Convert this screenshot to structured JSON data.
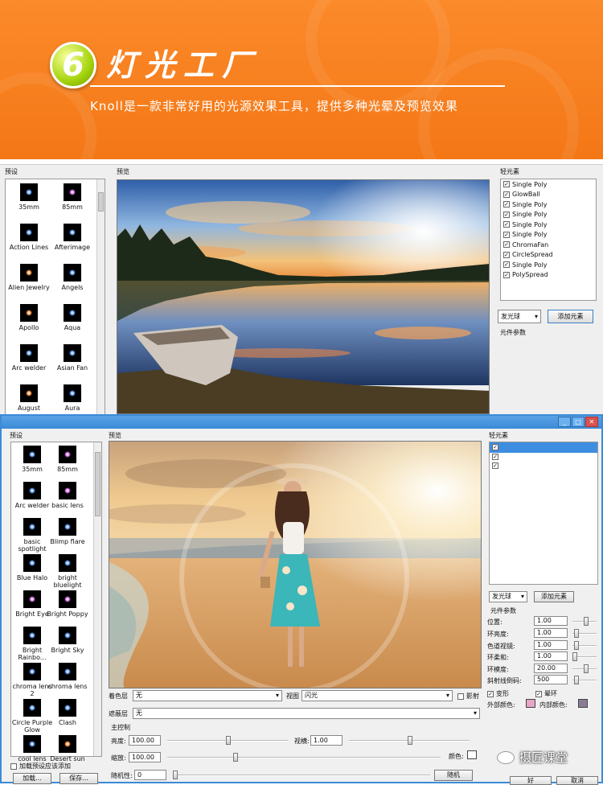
{
  "banner": {
    "number": "6",
    "title": "灯光工厂",
    "subtitle": "Knoll是一款非常好用的光源效果工具，提供多种光晕及预览效果"
  },
  "window1": {
    "presets_label": "预设",
    "preview_label": "预览",
    "elements_label": "轻元素",
    "presets": [
      "35mm",
      "85mm",
      "Action Lines",
      "Afterimage",
      "Alien Jewelry",
      "Angels",
      "Apollo",
      "Aqua",
      "Arc welder",
      "Asian Fan",
      "August",
      "Aura"
    ],
    "elements": [
      "Single Poly",
      "GlowBall",
      "Single Poly",
      "Single Poly",
      "Single Poly",
      "Single Poly",
      "ChromaFan",
      "CircleSpread",
      "Single Poly",
      "PolySpread"
    ],
    "element_select": "发光球",
    "add_button": "添加元素",
    "params_label": "元件参数"
  },
  "window2": {
    "presets_label": "预设",
    "preview_label": "预览",
    "elements_label": "轻元素",
    "presets": [
      "35mm",
      "85mm",
      "Arc welder",
      "basic lens",
      "basic spotlight",
      "Blimp flare",
      "Blue Halo",
      "bright bluelight",
      "Bright Eye",
      "Bright Poppy",
      "Bright Rainbo...",
      "Bright Sky",
      "chroma lens 2",
      "chroma lens",
      "Circle Purple Glow",
      "Clash",
      "cool lens",
      "Desert sun"
    ],
    "element_select": "发光球",
    "add_button": "添加元素",
    "params_label": "元件参数",
    "params": [
      {
        "label": "位置:",
        "value": "1.00"
      },
      {
        "label": "环亮度:",
        "value": "1.00"
      },
      {
        "label": "色道视镜:",
        "value": "1.00"
      },
      {
        "label": "环柔和:",
        "value": "1.00"
      },
      {
        "label": "环模度:",
        "value": "20.00"
      },
      {
        "label": "斜射线倒码:",
        "value": "500"
      }
    ],
    "check_transform": "变形",
    "check_ring": "晕环",
    "outer_color": "外部颜色:",
    "inner_color": "内部颜色:",
    "colors": {
      "outer": "#e7a6c8",
      "inner": "#8a7c95"
    },
    "load_checkbox": "加载预设应该添加",
    "load_button": "加载...",
    "save_button": "保存...",
    "mask_label": "着色层",
    "mask_value": "无",
    "view_label": "视图",
    "view_value": "闪光",
    "view_check": "影射",
    "occlude_label": "遮蔽层",
    "occlude_value": "无",
    "main_label": "主控制",
    "brightness_label": "亮度:",
    "brightness_value": "100.00",
    "scale_label": "缩放:",
    "scale_value": "100.00",
    "aspect_label": "视横:",
    "aspect_value": "1.00",
    "color_label": "颜色:",
    "random_label": "随机性:",
    "random_value": "0",
    "random_button": "随机",
    "ok_button": "好",
    "cancel_button": "取消"
  },
  "watermark": "摄匠课堂"
}
